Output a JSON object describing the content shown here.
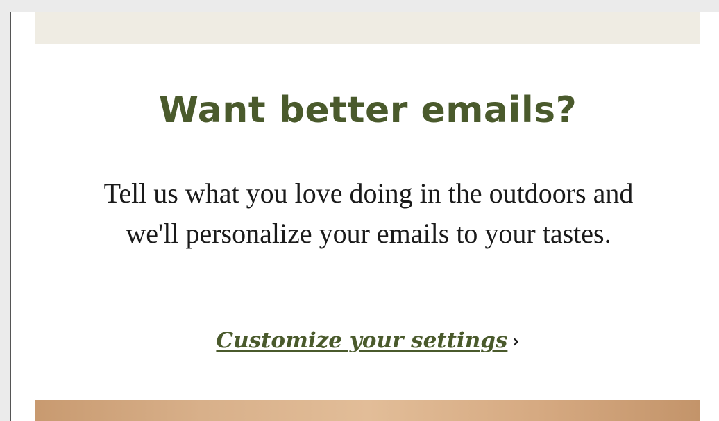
{
  "promo": {
    "headline": "Want better emails?",
    "body": "Tell us what you love doing in the outdoors and we'll personalize your emails to your tastes.",
    "cta_label": "Customize your settings",
    "cta_arrow": "›"
  },
  "colors": {
    "accent": "#4a5a2c",
    "band": "#efece3",
    "text": "#1a1a1a"
  }
}
